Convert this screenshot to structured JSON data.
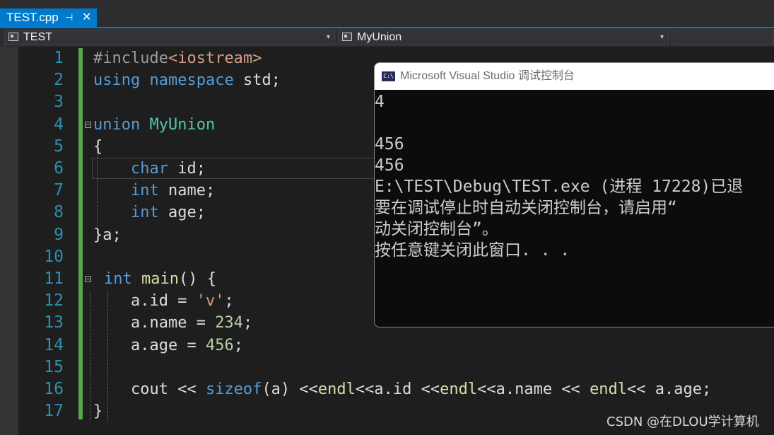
{
  "tab": {
    "title": "TEST.cpp",
    "pin_glyph": "⊣",
    "close_glyph": "✕"
  },
  "navbar": {
    "project_dropdown": "TEST",
    "scope_dropdown": "MyUnion",
    "member_dropdown": "",
    "arrow_glyph": "▾"
  },
  "editor": {
    "line_numbers": [
      "1",
      "2",
      "3",
      "4",
      "5",
      "6",
      "7",
      "8",
      "9",
      "10",
      "11",
      "12",
      "13",
      "14",
      "15",
      "16",
      "17"
    ],
    "lines": [
      [
        {
          "t": "#include",
          "c": "pp"
        },
        {
          "t": "<iostream>",
          "c": "inc"
        }
      ],
      [
        {
          "t": "using",
          "c": "kw"
        },
        {
          "t": " ",
          "c": ""
        },
        {
          "t": "namespace",
          "c": "kw"
        },
        {
          "t": " std;",
          "c": ""
        }
      ],
      [],
      [
        {
          "t": "union",
          "c": "kw"
        },
        {
          "t": " ",
          "c": ""
        },
        {
          "t": "MyUnion",
          "c": "type"
        }
      ],
      [
        {
          "t": "{",
          "c": ""
        }
      ],
      [
        {
          "t": "    ",
          "c": ""
        },
        {
          "t": "char",
          "c": "kw"
        },
        {
          "t": " id;",
          "c": ""
        }
      ],
      [
        {
          "t": "    ",
          "c": ""
        },
        {
          "t": "int",
          "c": "kw"
        },
        {
          "t": " name;",
          "c": ""
        }
      ],
      [
        {
          "t": "    ",
          "c": ""
        },
        {
          "t": "int",
          "c": "kw"
        },
        {
          "t": " age;",
          "c": ""
        }
      ],
      [
        {
          "t": "}a;",
          "c": ""
        }
      ],
      [],
      [
        {
          "t": "int",
          "c": "kw"
        },
        {
          "t": " ",
          "c": ""
        },
        {
          "t": "main",
          "c": "fn"
        },
        {
          "t": "() {",
          "c": ""
        }
      ],
      [
        {
          "t": "    a.id = ",
          "c": ""
        },
        {
          "t": "'v'",
          "c": "str"
        },
        {
          "t": ";",
          "c": ""
        }
      ],
      [
        {
          "t": "    a.name = ",
          "c": ""
        },
        {
          "t": "234",
          "c": "num"
        },
        {
          "t": ";",
          "c": ""
        }
      ],
      [
        {
          "t": "    a.age = ",
          "c": ""
        },
        {
          "t": "456",
          "c": "num"
        },
        {
          "t": ";",
          "c": ""
        }
      ],
      [],
      [
        {
          "t": "    cout << ",
          "c": ""
        },
        {
          "t": "sizeof",
          "c": "kw"
        },
        {
          "t": "(a) <<",
          "c": ""
        },
        {
          "t": "endl",
          "c": "fn"
        },
        {
          "t": "<<a.id <<",
          "c": ""
        },
        {
          "t": "endl",
          "c": "fn"
        },
        {
          "t": "<<a.name << ",
          "c": ""
        },
        {
          "t": "endl",
          "c": "fn"
        },
        {
          "t": "<< a.age;",
          "c": ""
        }
      ],
      [
        {
          "t": "}",
          "c": ""
        }
      ]
    ]
  },
  "console": {
    "title": "Microsoft Visual Studio 调试控制台",
    "icon_text": "C:\\",
    "lines": [
      "4",
      "",
      "456",
      "456",
      "E:\\TEST\\Debug\\TEST.exe (进程 17228)已退",
      "要在调试停止时自动关闭控制台，请启用“",
      "动关闭控制台”。",
      "按任意键关闭此窗口. . ."
    ]
  },
  "watermark": "CSDN @在DLOU学计算机"
}
